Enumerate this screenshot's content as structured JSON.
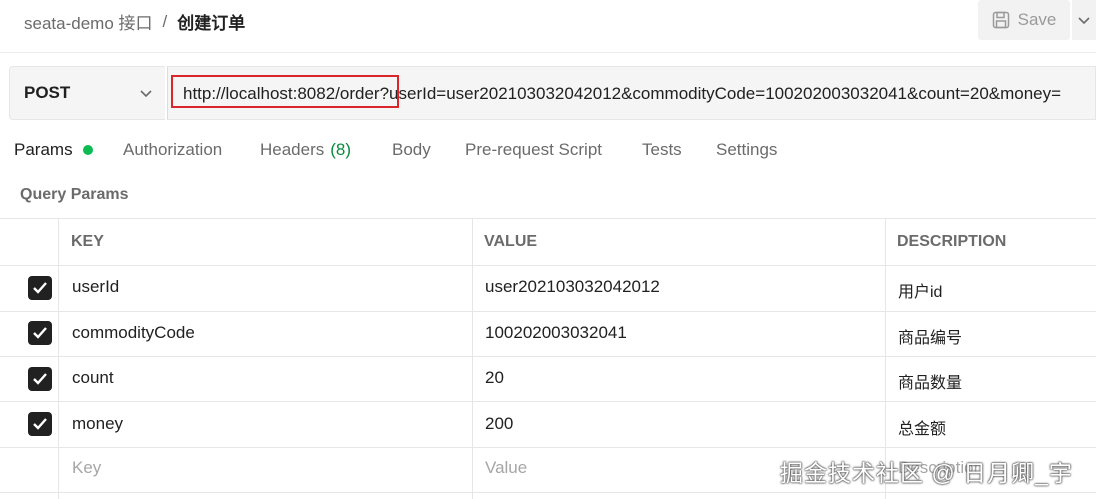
{
  "breadcrumb": {
    "collection": "seata-demo 接口",
    "separator": "/",
    "current": "创建订单"
  },
  "toolbar": {
    "save_label": "Save",
    "save_icon": "save-icon",
    "more_icon": "chevron-down-icon"
  },
  "request": {
    "method": "POST",
    "url_base": "http://localhost:8082/order",
    "url_query": "?userId=user202103032042012&commodityCode=100202003032041&count=20&money="
  },
  "tabs": {
    "params": "Params",
    "authorization": "Authorization",
    "headers": "Headers",
    "headers_count": "(8)",
    "body": "Body",
    "prerequest": "Pre-request Script",
    "tests": "Tests",
    "settings": "Settings"
  },
  "query_params": {
    "title": "Query Params",
    "columns": {
      "key": "KEY",
      "value": "VALUE",
      "description": "DESCRIPTION"
    },
    "rows": [
      {
        "key": "userId",
        "value": "user202103032042012",
        "description": "用户id"
      },
      {
        "key": "commodityCode",
        "value": "100202003032041",
        "description": "商品编号"
      },
      {
        "key": "count",
        "value": "20",
        "description": "商品数量"
      },
      {
        "key": "money",
        "value": "200",
        "description": "总金额"
      }
    ],
    "new_row": {
      "key_placeholder": "Key",
      "value_placeholder": "Value",
      "description_placeholder": "Description"
    }
  },
  "watermark": "掘金技术社区 @ 日月卿_宇",
  "colors": {
    "accent_green": "#0cbb52",
    "highlight_red": "#d9262b",
    "checkbox": "#212121"
  }
}
